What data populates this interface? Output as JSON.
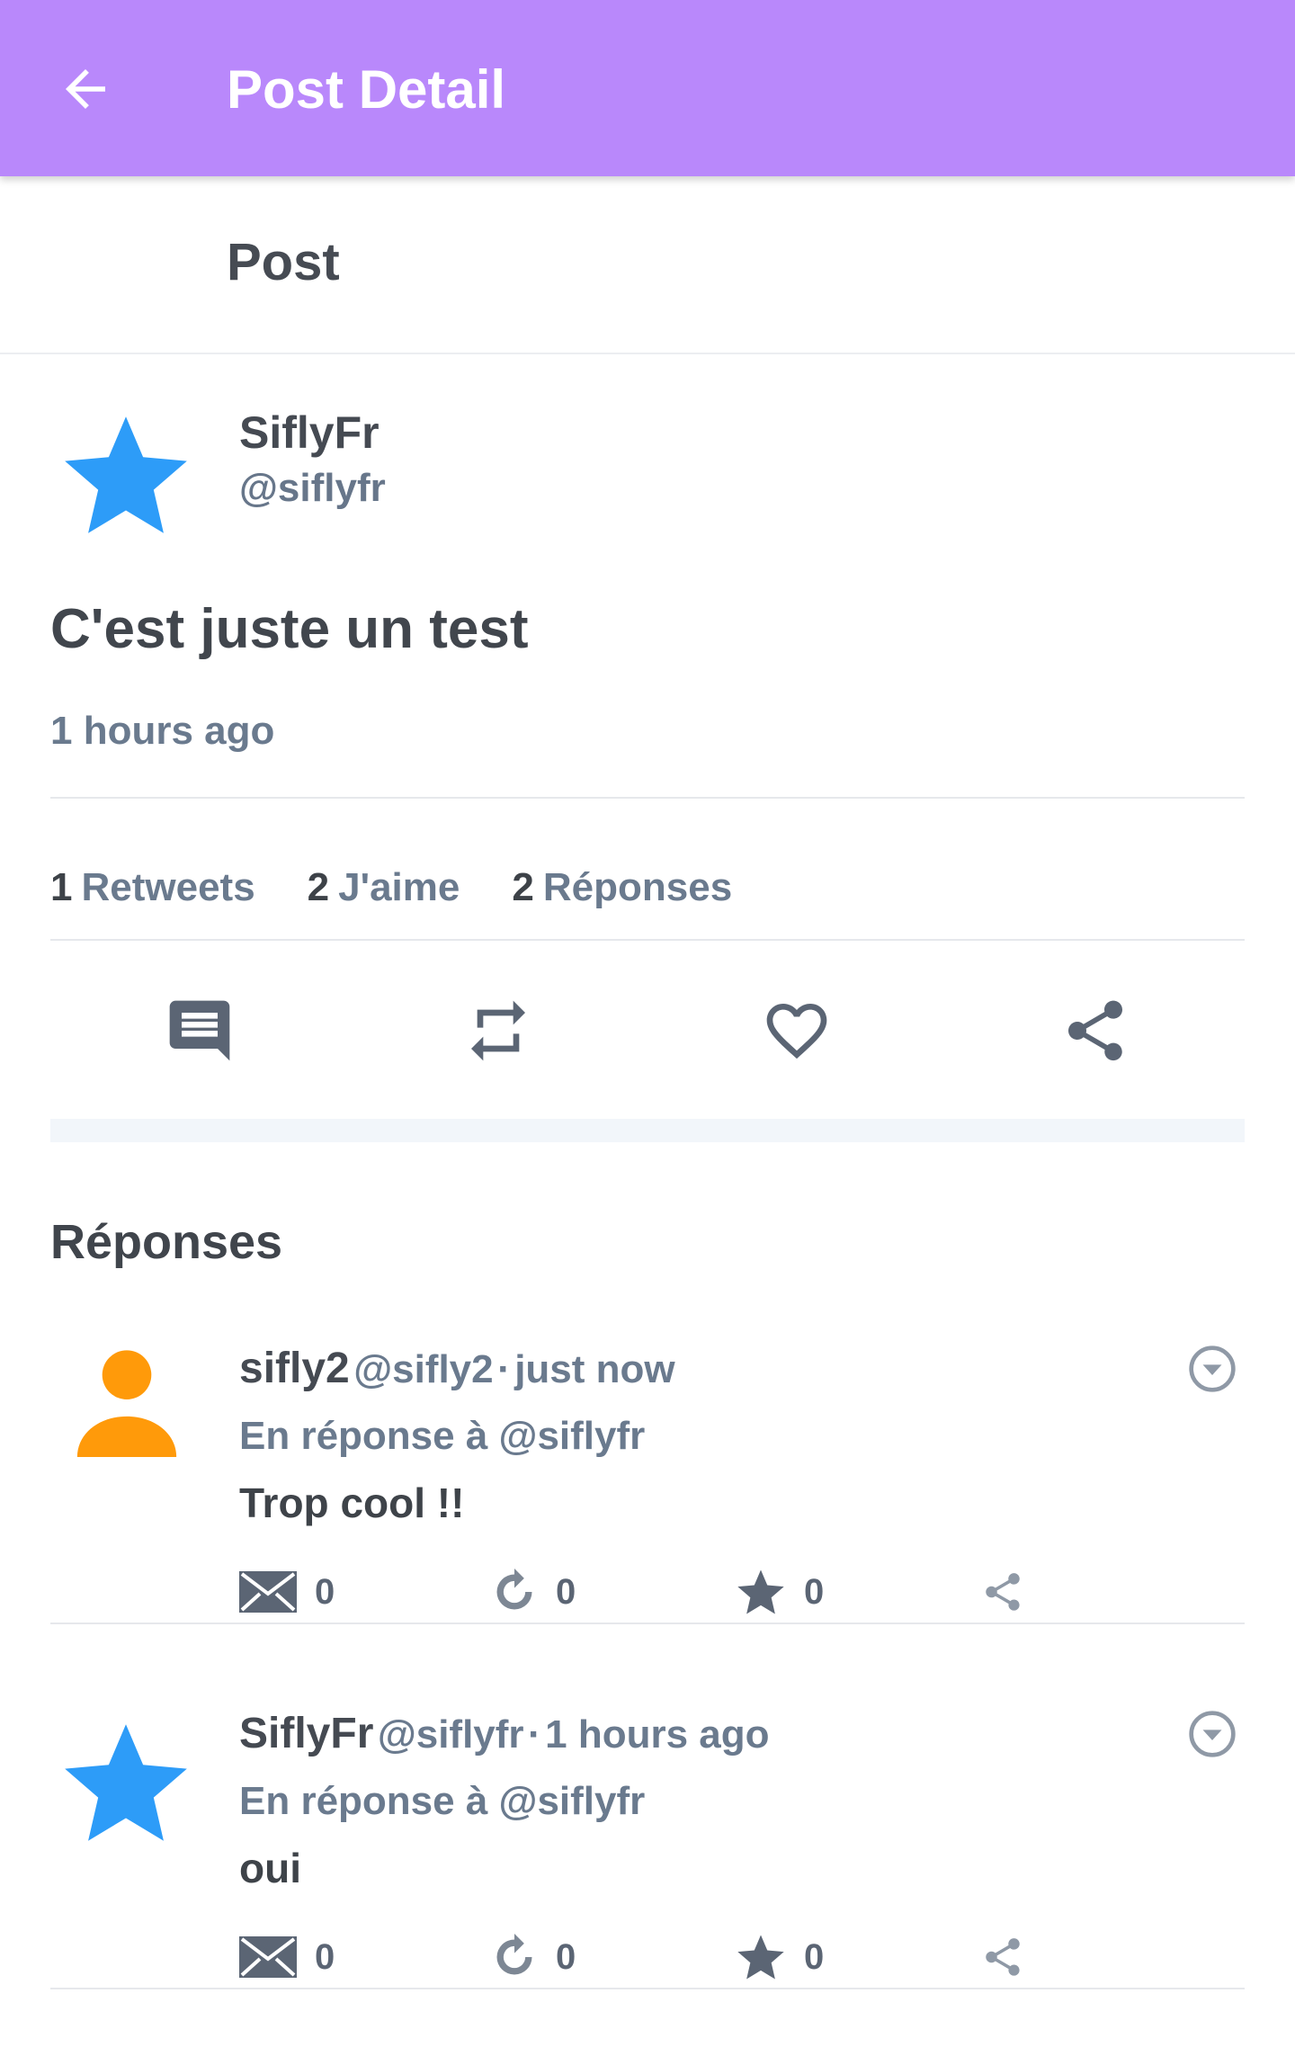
{
  "appbar": {
    "title": "Post Detail",
    "back_icon": "arrow-left-icon",
    "bg_color": "#b988fb"
  },
  "section": {
    "label": "Post"
  },
  "post": {
    "author_name": "SiflyFr",
    "author_handle": "@siflyfr",
    "avatar": "star-icon",
    "avatar_color": "#2d9cf8",
    "text": "C'est juste un test",
    "time": "1 hours ago",
    "stats": [
      {
        "count": "1",
        "label": "Retweets"
      },
      {
        "count": "2",
        "label": "J'aime"
      },
      {
        "count": "2",
        "label": "Réponses"
      }
    ],
    "actions": [
      "comment-icon",
      "retweet-icon",
      "heart-icon",
      "share-icon"
    ]
  },
  "replies": {
    "title": "Réponses",
    "items": [
      {
        "name": "sifly2",
        "handle": "@sifly2",
        "dot": "·",
        "time": "just now",
        "reply_to": "En réponse à @siflyfr",
        "text": "Trop cool !!",
        "avatar": "person-icon",
        "avatar_color": "#ff9a0a",
        "counts": [
          "0",
          "0",
          "0"
        ]
      },
      {
        "name": "SiflyFr",
        "handle": "@siflyfr",
        "dot": "·",
        "time": "1 hours ago",
        "reply_to": "En réponse à @siflyfr",
        "text": "oui",
        "avatar": "star-icon",
        "avatar_color": "#2d9cf8",
        "counts": [
          "0",
          "0",
          "0"
        ]
      }
    ]
  }
}
